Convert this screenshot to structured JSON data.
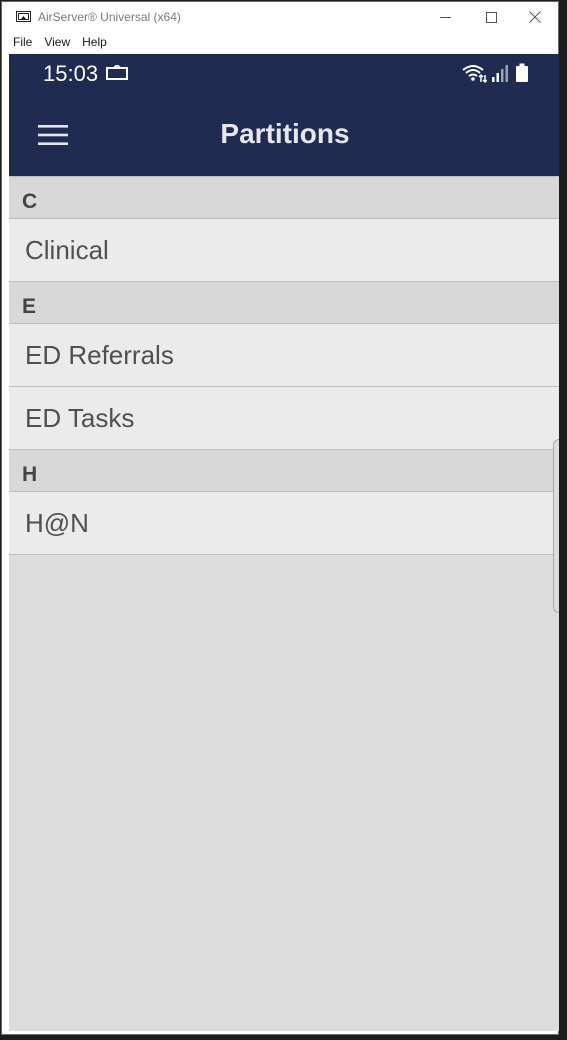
{
  "window": {
    "title": "AirServer® Universal (x64)",
    "app_icon": "airserver-icon",
    "controls": [
      "minimize-icon",
      "maximize-icon",
      "close-icon"
    ]
  },
  "menubar": {
    "items": [
      {
        "label": "File"
      },
      {
        "label": "View"
      },
      {
        "label": "Help"
      }
    ]
  },
  "statusbar": {
    "time": "15:03",
    "icons": [
      "cast-icon",
      "wifi-icon",
      "signal-icon",
      "battery-icon"
    ]
  },
  "appbar": {
    "title": "Partitions",
    "menu_icon": "hamburger-menu-icon"
  },
  "sections": [
    {
      "header": "C",
      "items": [
        {
          "label": "Clinical"
        }
      ]
    },
    {
      "header": "E",
      "items": [
        {
          "label": "ED Referrals"
        },
        {
          "label": "ED Tasks"
        }
      ]
    },
    {
      "header": "H",
      "items": [
        {
          "label": "H@N"
        }
      ]
    }
  ],
  "colors": {
    "appbar_bg": "#1f2b50",
    "list_bg": "#ebebeb",
    "section_bg": "#d8d8d8",
    "screen_bg": "#dcdcdc"
  }
}
